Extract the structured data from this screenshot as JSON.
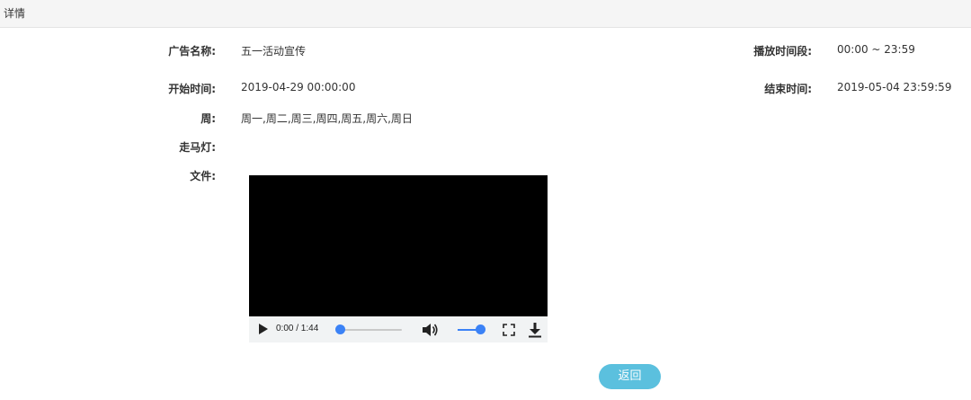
{
  "header": {
    "title": "详情"
  },
  "details": {
    "ad_name_label": "广告名称:",
    "ad_name_value": "五一活动宣传",
    "play_period_label": "播放时间段:",
    "play_period_value": "00:00 ~ 23:59",
    "start_time_label": "开始时间:",
    "start_time_value": "2019-04-29 00:00:00",
    "end_time_label": "结束时间:",
    "end_time_value": "2019-05-04 23:59:59",
    "week_label": "周:",
    "week_value": "周一,周二,周三,周四,周五,周六,周日",
    "marquee_label": "走马灯:",
    "marquee_value": "",
    "file_label": "文件:"
  },
  "player": {
    "time": "0:00 / 1:44",
    "progress": 0,
    "volume": 1,
    "accent_color": "#3b82f6",
    "icons": [
      "play-icon",
      "volume-icon",
      "fullscreen-icon",
      "download-icon"
    ]
  },
  "actions": {
    "back_label": "返回",
    "back_color": "#5bc0de"
  }
}
